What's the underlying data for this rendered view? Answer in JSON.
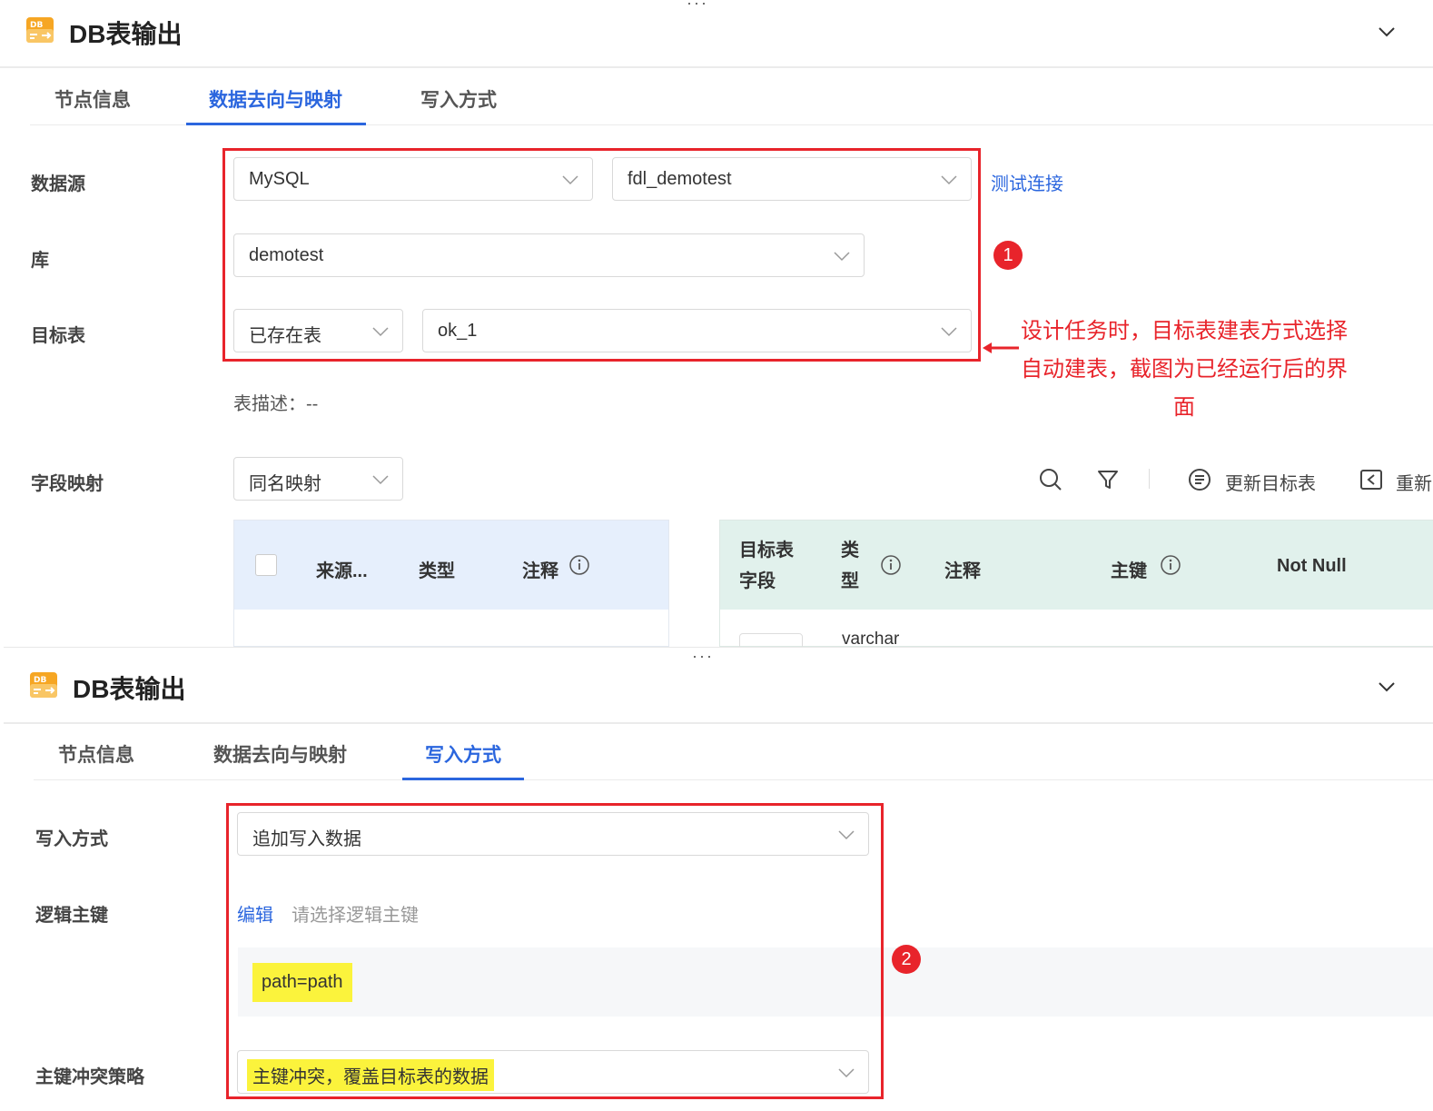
{
  "panel_top": {
    "title": "DB表输出",
    "logo_text": "DB",
    "tabs": [
      "节点信息",
      "数据去向与映射",
      "写入方式"
    ],
    "active_tab": 1,
    "datasource_label": "数据源",
    "datasource_type": "MySQL",
    "datasource_conn": "fdl_demotest",
    "test_conn_link": "测试连接",
    "db_label": "库",
    "db_value": "demotest",
    "target_label": "目标表",
    "target_mode": "已存在表",
    "target_table": "ok_1",
    "badge": "1",
    "annotation": "设计任务时，目标表建表方式选择自动建表，截图为已经运行后的界面",
    "table_desc": "表描述：--",
    "field_mapping_label": "字段映射",
    "field_mapping_value": "同名映射",
    "toolbar": {
      "update_target": "更新目标表",
      "reset": "重新"
    },
    "source_table": {
      "headers": [
        "来源...",
        "类型",
        "注释"
      ]
    },
    "target_table_grid": {
      "headers": [
        "目标表字段",
        "类型",
        "注释",
        "主键",
        "Not Null"
      ],
      "first_cell_type": "varchar"
    }
  },
  "panel_bottom": {
    "title": "DB表输出",
    "logo_text": "DB",
    "tabs": [
      "节点信息",
      "数据去向与映射",
      "写入方式"
    ],
    "active_tab": 2,
    "write_mode_label": "写入方式",
    "write_mode_value": "追加写入数据",
    "logic_key_label": "逻辑主键",
    "edit_link": "编辑",
    "logic_key_placeholder": "请选择逻辑主键",
    "logic_key_mapping": "path=path",
    "badge": "2",
    "conflict_label": "主键冲突策略",
    "conflict_value": "主键冲突，覆盖目标表的数据"
  },
  "colors": {
    "accent": "#2b66de",
    "annotation_red": "#e8242b",
    "highlight": "#fbf33c"
  }
}
